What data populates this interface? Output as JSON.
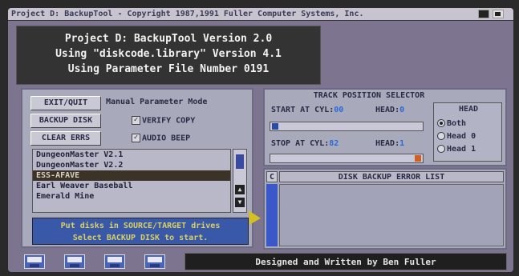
{
  "window": {
    "title": "Project D: BackupTool - Copyright 1987,1991 Fuller Computer Systems, Inc."
  },
  "header": {
    "line1": "Project D: BackupTool Version 2.0",
    "line2": "Using \"diskcode.library\" Version 4.1",
    "line3": "Using Parameter File Number 0191"
  },
  "controls": {
    "exit_label": "EXIT/QUIT",
    "backup_label": "BACKUP DISK",
    "clear_label": "CLEAR ERRS",
    "mode_label": "Manual Parameter Mode",
    "verify_label": "VERIFY COPY",
    "audio_label": "AUDIO BEEP"
  },
  "gamelist": {
    "items": [
      "DungeonMaster V2.1",
      "DungeonMaster V2.2",
      "ESS-AFAVE",
      "Earl Weaver Baseball",
      "Emerald Mine"
    ]
  },
  "status": {
    "line1": "Put disks in SOURCE/TARGET drives",
    "line2": "Select BACKUP DISK to start."
  },
  "track_selector": {
    "title": "TRACK POSITION SELECTOR",
    "start_label": "START AT CYL:",
    "start_value": "00",
    "start_head_label": "HEAD:",
    "start_head_value": "0",
    "stop_label": "STOP AT CYL:",
    "stop_value": "82",
    "stop_head_label": "HEAD:",
    "stop_head_value": "1",
    "head_title": "HEAD",
    "head_options": [
      "Both",
      "Head 0",
      "Head 1"
    ],
    "head_selected": "Both"
  },
  "errors": {
    "column_label": "C",
    "title": "DISK BACKUP ERROR LIST"
  },
  "footer": {
    "credit": "Designed and Written by Ben Fuller"
  }
}
